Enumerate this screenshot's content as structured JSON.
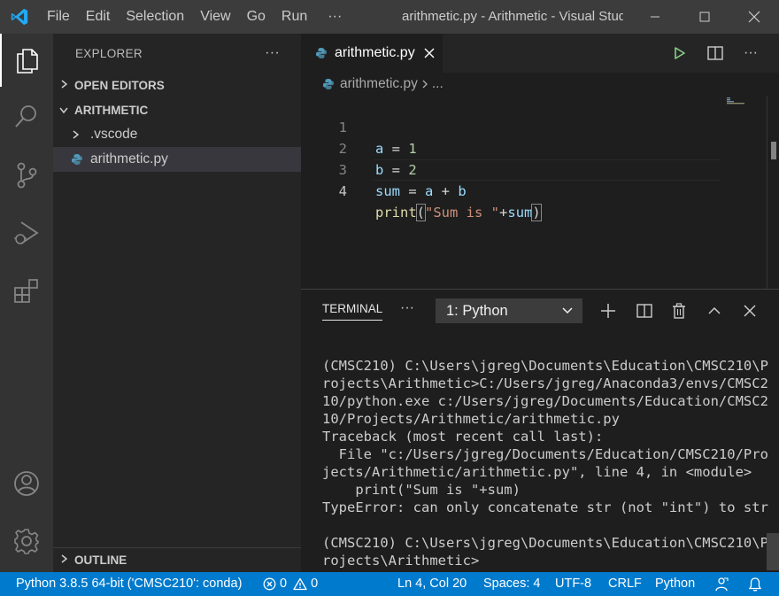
{
  "titlebar": {
    "menu": [
      "File",
      "Edit",
      "Selection",
      "View",
      "Go",
      "Run"
    ],
    "more": "···",
    "window_title": "arithmetic.py - Arithmetic - Visual Studio Code"
  },
  "sidebar": {
    "title": "EXPLORER",
    "more": "···",
    "open_editors": "OPEN EDITORS",
    "folder": "ARITHMETIC",
    "items": [
      {
        "label": ".vscode"
      },
      {
        "label": "arithmetic.py"
      }
    ],
    "outline": "OUTLINE"
  },
  "editor": {
    "tab_label": "arithmetic.py",
    "breadcrumb_file": "arithmetic.py",
    "breadcrumb_more": "...",
    "lines": [
      {
        "no": "1",
        "a": "a",
        "b": " = ",
        "c": "1"
      },
      {
        "no": "2",
        "a": "b",
        "b": " = ",
        "c": "2"
      },
      {
        "no": "3",
        "a": "sum",
        "b": " = ",
        "c": "a",
        "d": " + ",
        "e": "b"
      },
      {
        "no": "4",
        "fn": "print",
        "open": "(",
        "str": "\"Sum is \"",
        "plus": "+",
        "var": "sum",
        "close": ")"
      }
    ]
  },
  "panel": {
    "tab": "TERMINAL",
    "more": "···",
    "selected_terminal": "1: Python",
    "terminal_text": "(CMSC210) C:\\Users\\jgreg\\Documents\\Education\\CMSC210\\P\nrojects\\Arithmetic>C:/Users/jgreg/Anaconda3/envs/CMSC2\n10/python.exe c:/Users/jgreg/Documents/Education/CMSC2\n10/Projects/Arithmetic/arithmetic.py\nTraceback (most recent call last):\n  File \"c:/Users/jgreg/Documents/Education/CMSC210/Pro\njects/Arithmetic/arithmetic.py\", line 4, in <module>\n    print(\"Sum is \"+sum)\nTypeError: can only concatenate str (not \"int\") to str\n\n(CMSC210) C:\\Users\\jgreg\\Documents\\Education\\CMSC210\\P\nrojects\\Arithmetic>"
  },
  "statusbar": {
    "interpreter": "Python 3.8.5 64-bit ('CMSC210': conda)",
    "errors": "0",
    "warnings": "0",
    "position": "Ln 4, Col 20",
    "spaces": "Spaces: 4",
    "encoding": "UTF-8",
    "eol": "CRLF",
    "language": "Python"
  },
  "colors": {
    "accent": "#007acc",
    "python_icon": "#519aba",
    "run_green": "#89d185"
  }
}
